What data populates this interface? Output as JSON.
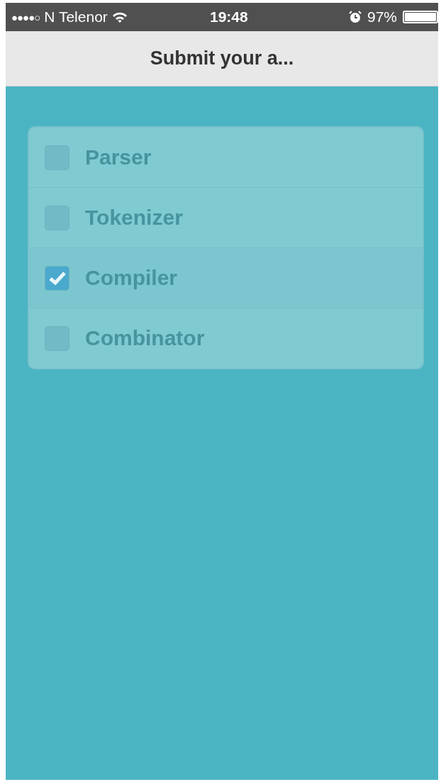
{
  "status_bar": {
    "signal": "●●●●○",
    "carrier": "N Telenor",
    "time": "19:48",
    "battery": "97%"
  },
  "nav_bar": {
    "title": "Submit your a..."
  },
  "options": [
    {
      "label": "Parser",
      "checked": false
    },
    {
      "label": "Tokenizer",
      "checked": false
    },
    {
      "label": "Compiler",
      "checked": true
    },
    {
      "label": "Combinator",
      "checked": false
    }
  ]
}
